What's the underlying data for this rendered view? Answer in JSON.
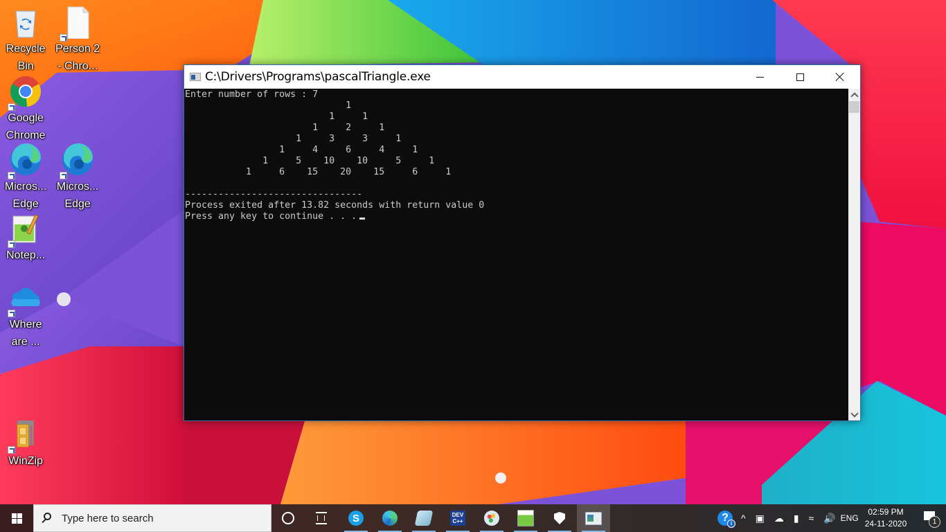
{
  "desktop": {
    "icons": [
      {
        "label_line1": "Recycle",
        "label_line2": "Bin",
        "icon": "recycle-bin-icon"
      },
      {
        "label_line1": "Person 2",
        "label_line2": "- Chro...",
        "icon": "blank-document-icon"
      },
      {
        "label_line1": "Google",
        "label_line2": "Chrome",
        "icon": "chrome-icon"
      },
      {
        "label_line1": "Micros...",
        "label_line2": "Edge",
        "icon": "edge-icon"
      },
      {
        "label_line1": "Micros...",
        "label_line2": "Edge",
        "icon": "edge-icon"
      },
      {
        "label_line1": "Notep...",
        "label_line2": "",
        "icon": "notepad-plus-plus-icon"
      },
      {
        "label_line1": "Where",
        "label_line2": "are ...",
        "icon": "onedrive-icon"
      },
      {
        "label_line1": "WinZip",
        "label_line2": "",
        "icon": "winzip-icon"
      }
    ]
  },
  "console": {
    "title": "C:\\Drivers\\Programs\\pascalTriangle.exe",
    "buttons": {
      "minimize": "minimize",
      "maximize": "maximize",
      "close": "close"
    },
    "lines": [
      "Enter number of rows : 7",
      "                             1",
      "                          1     1",
      "                       1     2     1",
      "                    1     3     3     1",
      "                 1     4     6     4     1",
      "              1     5    10    10     5     1",
      "           1     6    15    20    15     6     1",
      "",
      "--------------------------------",
      "Process exited after 13.82 seconds with return value 0",
      "Press any key to continue . . ."
    ],
    "rows_entered": 7,
    "exit_time_seconds": 13.82,
    "return_value": 0
  },
  "taskbar": {
    "search_placeholder": "Type here to search",
    "pinned": [
      {
        "name": "skype",
        "glyph": "S",
        "running": true
      },
      {
        "name": "edge",
        "glyph": "",
        "running": true
      },
      {
        "name": "notepad",
        "glyph": "",
        "running": true
      },
      {
        "name": "dev-cpp",
        "glyph": "DEV C++",
        "running": true
      },
      {
        "name": "paint",
        "glyph": "",
        "running": true
      },
      {
        "name": "notepad-plus-plus",
        "glyph": "",
        "running": true
      },
      {
        "name": "windows-security",
        "glyph": "",
        "running": true
      },
      {
        "name": "console-host",
        "glyph": "",
        "running": true,
        "active": true
      }
    ],
    "tray": {
      "help_glyph": "?",
      "chevron": "^",
      "language": "ENG",
      "time": "02:59 PM",
      "date": "24-11-2020",
      "notification_count": "1"
    }
  }
}
